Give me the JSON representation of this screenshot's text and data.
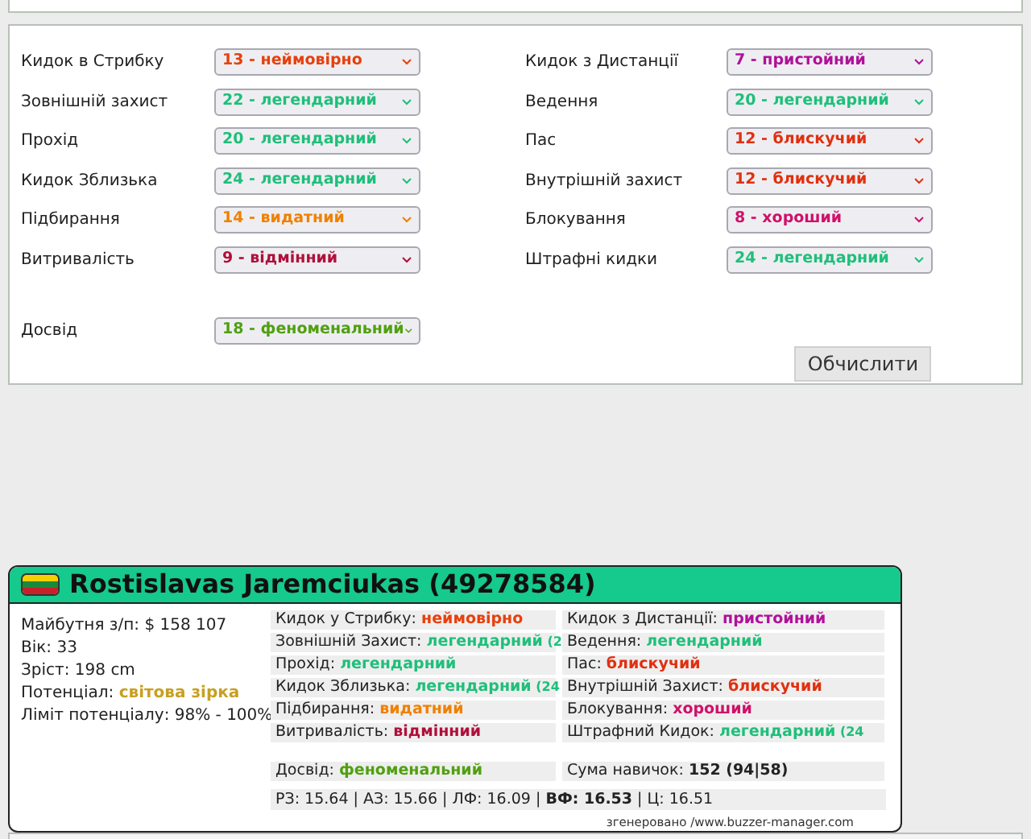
{
  "form": {
    "left": [
      {
        "label": "Кидок в Стрибку",
        "value": "13 - неймовірно",
        "color": "#e8400c"
      },
      {
        "label": "Зовнішній захист",
        "value": "22 - легендарний",
        "color": "#1fbf7a"
      },
      {
        "label": "Прохід",
        "value": "20 - легендарний",
        "color": "#1fbf7a"
      },
      {
        "label": "Кидок Зблизька",
        "value": "24 - легендарний",
        "color": "#1fbf7a"
      },
      {
        "label": "Підбирання",
        "value": "14 - видатний",
        "color": "#f08000"
      },
      {
        "label": "Витривалість",
        "value": "9 - відмінний",
        "color": "#b0103a"
      }
    ],
    "right": [
      {
        "label": "Кидок з Дистанції",
        "value": "7 - пристойний",
        "color": "#b0109a"
      },
      {
        "label": "Ведення",
        "value": "20 - легендарний",
        "color": "#1fbf7a"
      },
      {
        "label": "Пас",
        "value": "12 - блискучий",
        "color": "#e03010"
      },
      {
        "label": "Внутрішній захист",
        "value": "12 - блискучий",
        "color": "#e03010"
      },
      {
        "label": "Блокування",
        "value": "8 - хороший",
        "color": "#d0106a"
      },
      {
        "label": "Штрафні кидки",
        "value": "24 - легендарний",
        "color": "#1fbf7a"
      }
    ],
    "experience": {
      "label": "Досвід",
      "value": "18 - феноменальний",
      "color": "#50a010"
    },
    "button": "Обчислити"
  },
  "card": {
    "name": "Rostislavas Jaremciukas (49278584)",
    "info": [
      {
        "label": "Майбутня з/п:",
        "value": "$ 158 107"
      },
      {
        "label": "Вік:",
        "value": "33"
      },
      {
        "label": "Зріст:",
        "value": "198 cm"
      },
      {
        "label": "Потенціал:",
        "value": "світова зірка",
        "color": "#c8a020"
      },
      {
        "label": "Ліміт потенціалу:",
        "value": "98% - 100%"
      }
    ],
    "skills_left": [
      {
        "label": "Кидок у Стрибку:",
        "value": "неймовірно",
        "color": "#e8400c"
      },
      {
        "label": "Зовнішній Захист:",
        "value": "легендарний",
        "color": "#1fbf7a",
        "extra": "(2"
      },
      {
        "label": "Прохід:",
        "value": "легендарний",
        "color": "#1fbf7a"
      },
      {
        "label": "Кидок Зблизька:",
        "value": "легендарний",
        "color": "#1fbf7a",
        "extra": "(24"
      },
      {
        "label": "Підбирання:",
        "value": "видатний",
        "color": "#f08000"
      },
      {
        "label": "Витривалість:",
        "value": "відмінний",
        "color": "#b0103a"
      }
    ],
    "skills_right": [
      {
        "label": "Кидок з Дистанції:",
        "value": "пристойний",
        "color": "#b0109a"
      },
      {
        "label": "Ведення:",
        "value": "легендарний",
        "color": "#1fbf7a"
      },
      {
        "label": "Пас:",
        "value": "блискучий",
        "color": "#e03010"
      },
      {
        "label": "Внутрішній Захист:",
        "value": "блискучий",
        "color": "#e03010"
      },
      {
        "label": "Блокування:",
        "value": "хороший",
        "color": "#d0106a"
      },
      {
        "label": "Штрафний Кидок:",
        "value": "легендарний",
        "color": "#1fbf7a",
        "extra": "(24"
      }
    ],
    "experience": {
      "label": "Досвід:",
      "value": "феноменальний",
      "color": "#50a010"
    },
    "sum": {
      "label": "Сума навичок:",
      "value": "152 (94|58)"
    },
    "ratings": "РЗ: 15.64 | АЗ: 15.66 | ЛФ: 16.09 | **ВФ: 16.53** | Ц: 16.51",
    "footer": "згенеровано /www.buzzer-manager.com"
  }
}
